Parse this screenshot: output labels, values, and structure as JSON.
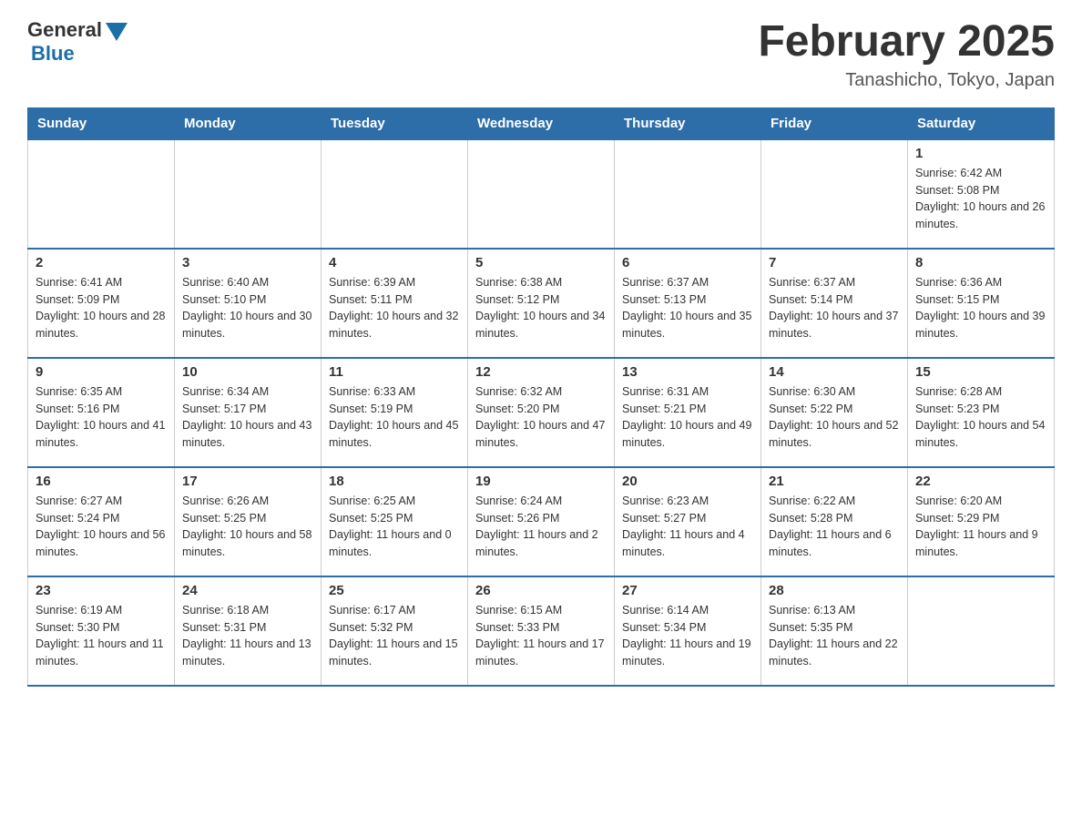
{
  "header": {
    "logo_general": "General",
    "logo_blue": "Blue",
    "month_title": "February 2025",
    "location": "Tanashicho, Tokyo, Japan"
  },
  "days_of_week": [
    "Sunday",
    "Monday",
    "Tuesday",
    "Wednesday",
    "Thursday",
    "Friday",
    "Saturday"
  ],
  "weeks": [
    [
      {
        "day": "",
        "sunrise": "",
        "sunset": "",
        "daylight": ""
      },
      {
        "day": "",
        "sunrise": "",
        "sunset": "",
        "daylight": ""
      },
      {
        "day": "",
        "sunrise": "",
        "sunset": "",
        "daylight": ""
      },
      {
        "day": "",
        "sunrise": "",
        "sunset": "",
        "daylight": ""
      },
      {
        "day": "",
        "sunrise": "",
        "sunset": "",
        "daylight": ""
      },
      {
        "day": "",
        "sunrise": "",
        "sunset": "",
        "daylight": ""
      },
      {
        "day": "1",
        "sunrise": "Sunrise: 6:42 AM",
        "sunset": "Sunset: 5:08 PM",
        "daylight": "Daylight: 10 hours and 26 minutes."
      }
    ],
    [
      {
        "day": "2",
        "sunrise": "Sunrise: 6:41 AM",
        "sunset": "Sunset: 5:09 PM",
        "daylight": "Daylight: 10 hours and 28 minutes."
      },
      {
        "day": "3",
        "sunrise": "Sunrise: 6:40 AM",
        "sunset": "Sunset: 5:10 PM",
        "daylight": "Daylight: 10 hours and 30 minutes."
      },
      {
        "day": "4",
        "sunrise": "Sunrise: 6:39 AM",
        "sunset": "Sunset: 5:11 PM",
        "daylight": "Daylight: 10 hours and 32 minutes."
      },
      {
        "day": "5",
        "sunrise": "Sunrise: 6:38 AM",
        "sunset": "Sunset: 5:12 PM",
        "daylight": "Daylight: 10 hours and 34 minutes."
      },
      {
        "day": "6",
        "sunrise": "Sunrise: 6:37 AM",
        "sunset": "Sunset: 5:13 PM",
        "daylight": "Daylight: 10 hours and 35 minutes."
      },
      {
        "day": "7",
        "sunrise": "Sunrise: 6:37 AM",
        "sunset": "Sunset: 5:14 PM",
        "daylight": "Daylight: 10 hours and 37 minutes."
      },
      {
        "day": "8",
        "sunrise": "Sunrise: 6:36 AM",
        "sunset": "Sunset: 5:15 PM",
        "daylight": "Daylight: 10 hours and 39 minutes."
      }
    ],
    [
      {
        "day": "9",
        "sunrise": "Sunrise: 6:35 AM",
        "sunset": "Sunset: 5:16 PM",
        "daylight": "Daylight: 10 hours and 41 minutes."
      },
      {
        "day": "10",
        "sunrise": "Sunrise: 6:34 AM",
        "sunset": "Sunset: 5:17 PM",
        "daylight": "Daylight: 10 hours and 43 minutes."
      },
      {
        "day": "11",
        "sunrise": "Sunrise: 6:33 AM",
        "sunset": "Sunset: 5:19 PM",
        "daylight": "Daylight: 10 hours and 45 minutes."
      },
      {
        "day": "12",
        "sunrise": "Sunrise: 6:32 AM",
        "sunset": "Sunset: 5:20 PM",
        "daylight": "Daylight: 10 hours and 47 minutes."
      },
      {
        "day": "13",
        "sunrise": "Sunrise: 6:31 AM",
        "sunset": "Sunset: 5:21 PM",
        "daylight": "Daylight: 10 hours and 49 minutes."
      },
      {
        "day": "14",
        "sunrise": "Sunrise: 6:30 AM",
        "sunset": "Sunset: 5:22 PM",
        "daylight": "Daylight: 10 hours and 52 minutes."
      },
      {
        "day": "15",
        "sunrise": "Sunrise: 6:28 AM",
        "sunset": "Sunset: 5:23 PM",
        "daylight": "Daylight: 10 hours and 54 minutes."
      }
    ],
    [
      {
        "day": "16",
        "sunrise": "Sunrise: 6:27 AM",
        "sunset": "Sunset: 5:24 PM",
        "daylight": "Daylight: 10 hours and 56 minutes."
      },
      {
        "day": "17",
        "sunrise": "Sunrise: 6:26 AM",
        "sunset": "Sunset: 5:25 PM",
        "daylight": "Daylight: 10 hours and 58 minutes."
      },
      {
        "day": "18",
        "sunrise": "Sunrise: 6:25 AM",
        "sunset": "Sunset: 5:25 PM",
        "daylight": "Daylight: 11 hours and 0 minutes."
      },
      {
        "day": "19",
        "sunrise": "Sunrise: 6:24 AM",
        "sunset": "Sunset: 5:26 PM",
        "daylight": "Daylight: 11 hours and 2 minutes."
      },
      {
        "day": "20",
        "sunrise": "Sunrise: 6:23 AM",
        "sunset": "Sunset: 5:27 PM",
        "daylight": "Daylight: 11 hours and 4 minutes."
      },
      {
        "day": "21",
        "sunrise": "Sunrise: 6:22 AM",
        "sunset": "Sunset: 5:28 PM",
        "daylight": "Daylight: 11 hours and 6 minutes."
      },
      {
        "day": "22",
        "sunrise": "Sunrise: 6:20 AM",
        "sunset": "Sunset: 5:29 PM",
        "daylight": "Daylight: 11 hours and 9 minutes."
      }
    ],
    [
      {
        "day": "23",
        "sunrise": "Sunrise: 6:19 AM",
        "sunset": "Sunset: 5:30 PM",
        "daylight": "Daylight: 11 hours and 11 minutes."
      },
      {
        "day": "24",
        "sunrise": "Sunrise: 6:18 AM",
        "sunset": "Sunset: 5:31 PM",
        "daylight": "Daylight: 11 hours and 13 minutes."
      },
      {
        "day": "25",
        "sunrise": "Sunrise: 6:17 AM",
        "sunset": "Sunset: 5:32 PM",
        "daylight": "Daylight: 11 hours and 15 minutes."
      },
      {
        "day": "26",
        "sunrise": "Sunrise: 6:15 AM",
        "sunset": "Sunset: 5:33 PM",
        "daylight": "Daylight: 11 hours and 17 minutes."
      },
      {
        "day": "27",
        "sunrise": "Sunrise: 6:14 AM",
        "sunset": "Sunset: 5:34 PM",
        "daylight": "Daylight: 11 hours and 19 minutes."
      },
      {
        "day": "28",
        "sunrise": "Sunrise: 6:13 AM",
        "sunset": "Sunset: 5:35 PM",
        "daylight": "Daylight: 11 hours and 22 minutes."
      },
      {
        "day": "",
        "sunrise": "",
        "sunset": "",
        "daylight": ""
      }
    ]
  ]
}
